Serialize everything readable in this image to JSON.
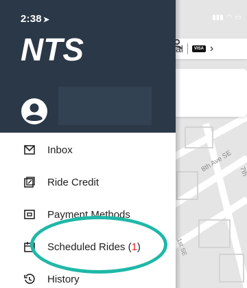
{
  "status_bar": {
    "time": "2:38",
    "location_glyph": "➤"
  },
  "brand": {
    "logo_text": "NTS",
    "header_color": "#2b3847"
  },
  "user": {
    "avatar_icon": "user-circle-icon"
  },
  "map": {
    "search_fragment": "al",
    "payment_badge": "VISA",
    "street_1": "8th Ave SE",
    "street_2": "1st SE",
    "street_3": "7th"
  },
  "menu": {
    "items": [
      {
        "label": "Inbox",
        "icon": "mail-icon"
      },
      {
        "label": "Ride Credit",
        "icon": "ride-credit-icon"
      },
      {
        "label": "Payment Methods",
        "icon": "payment-icon"
      },
      {
        "label": "Scheduled Rides (",
        "count": "1",
        "suffix": ")",
        "icon": "calendar-icon"
      },
      {
        "label": "History",
        "icon": "history-icon"
      }
    ]
  },
  "colors": {
    "highlight": "#1fb8a8",
    "count_red": "#e02020"
  }
}
